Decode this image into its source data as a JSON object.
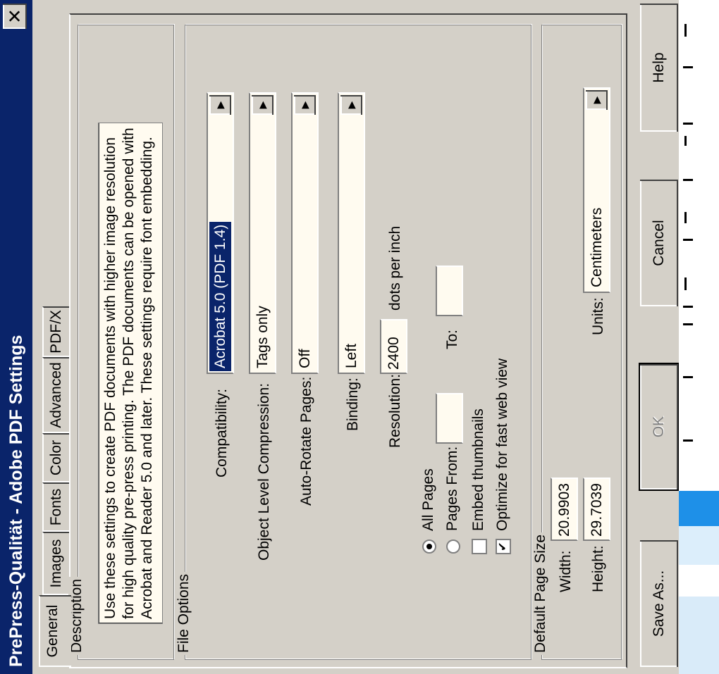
{
  "window": {
    "title": "PrePress-Qualität - Adobe PDF Settings",
    "close_glyph": "✕"
  },
  "tabs": [
    {
      "label": "General",
      "active": true
    },
    {
      "label": "Images"
    },
    {
      "label": "Fonts"
    },
    {
      "label": "Color"
    },
    {
      "label": "Advanced"
    },
    {
      "label": "PDF/X"
    }
  ],
  "description": {
    "legend": "Description",
    "text": "Use these settings to create PDF documents with higher image resolution for high quality pre-press printing. The PDF documents can be opened with Acrobat and Reader 5.0 and later. These settings require font embedding."
  },
  "file_options": {
    "legend": "File Options",
    "compatibility": {
      "label": "Compatibility:",
      "value": "Acrobat 5.0 (PDF 1.4)"
    },
    "object_compression": {
      "label": "Object Level Compression:",
      "value": "Tags only"
    },
    "auto_rotate": {
      "label": "Auto-Rotate Pages:",
      "value": "Off"
    },
    "binding": {
      "label": "Binding:",
      "value": "Left"
    },
    "resolution": {
      "label": "Resolution:",
      "value": "2400",
      "unit": "dots per inch"
    },
    "all_pages": {
      "label": "All Pages",
      "checked": true
    },
    "pages_from": {
      "label": "Pages From:",
      "from_value": "",
      "to_label": "To:",
      "to_value": ""
    },
    "embed_thumbnails": {
      "label": "Embed thumbnails",
      "checked": false
    },
    "optimize_web": {
      "label": "Optimize for fast web view",
      "checked": true
    }
  },
  "page_size": {
    "legend": "Default Page Size",
    "width": {
      "label": "Width:",
      "value": "20.9903"
    },
    "height": {
      "label": "Height:",
      "value": "29.7039"
    },
    "units": {
      "label": "Units:",
      "value": "Centimeters"
    }
  },
  "buttons": {
    "save_as": "Save As...",
    "ok": "OK",
    "cancel": "Cancel",
    "help": "Help"
  },
  "icons": {
    "dropdown_arrow": "▶",
    "check_mark": "✔"
  },
  "colors": {
    "titlebar": "#0a246a",
    "face": "#d4d0c8",
    "field": "#fffbf0"
  }
}
